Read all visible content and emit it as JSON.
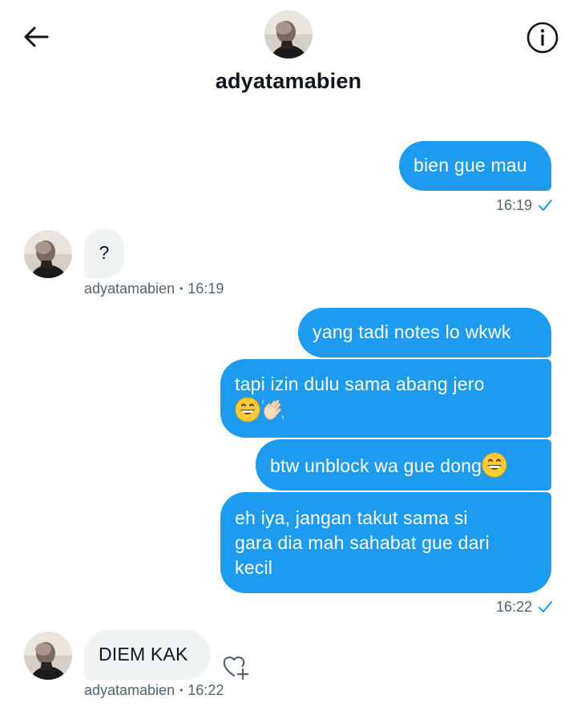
{
  "header": {
    "username": "adyatamabien",
    "back_icon": "arrow-left-icon",
    "info_icon": "info-circle-icon"
  },
  "colors": {
    "accent": "#1d9bf0",
    "incoming_bubble": "#eff3f4",
    "meta_text": "#536471"
  },
  "messages": [
    {
      "direction": "outgoing",
      "text": "bien gue mau"
    },
    {
      "direction": "outgoing",
      "meta_time": "16:19",
      "seen": true
    },
    {
      "direction": "incoming",
      "text": "?",
      "meta_sender": "adyatamabien",
      "meta_sep": "•",
      "meta_time": "16:19"
    },
    {
      "direction": "outgoing",
      "text": "yang tadi notes lo wkwk"
    },
    {
      "direction": "outgoing",
      "text": "tapi izin dulu sama abang jero",
      "emojis": [
        "grinning-face-icon",
        "waving-hand-icon"
      ]
    },
    {
      "direction": "outgoing",
      "text": "btw unblock wa gue dong",
      "emojis": [
        "grinning-face-icon"
      ]
    },
    {
      "direction": "outgoing",
      "text_lines": [
        "eh iya, jangan takut sama si",
        "gara dia mah sahabat gue dari",
        "kecil"
      ]
    },
    {
      "direction": "outgoing",
      "meta_time": "16:22",
      "seen": true
    },
    {
      "direction": "incoming",
      "text": "DIEM KAK",
      "meta_sender": "adyatamabien",
      "meta_sep": "•",
      "meta_time": "16:22",
      "reaction_icon": "heart-plus-icon"
    }
  ]
}
